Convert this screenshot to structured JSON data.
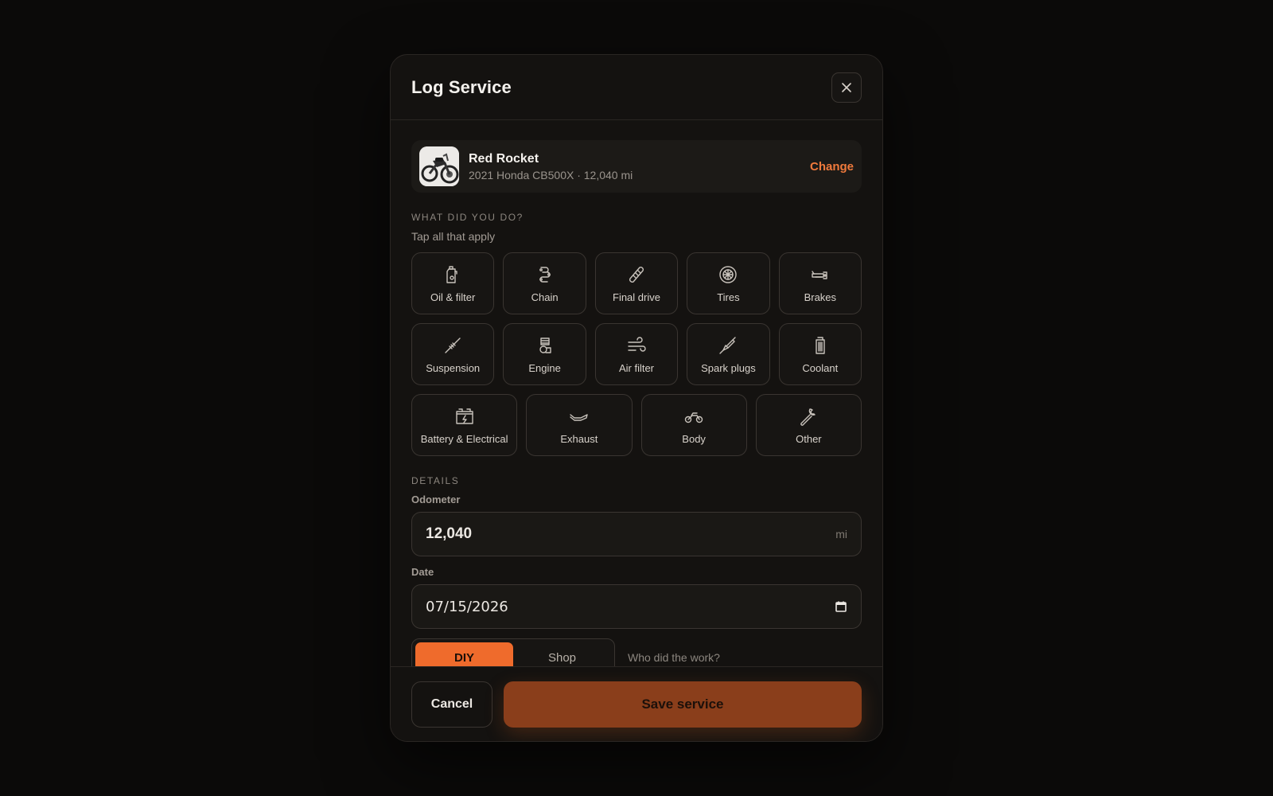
{
  "modal": {
    "title": "Log Service"
  },
  "bike": {
    "name": "Red Rocket",
    "meta": "2021 Honda CB500X · 12,040 mi",
    "change_label": "Change"
  },
  "what_section": {
    "label": "WHAT DID YOU DO?",
    "hint": "Tap all that apply",
    "row1": [
      {
        "label": "Oil & filter",
        "icon": "oil-can-icon"
      },
      {
        "label": "Chain",
        "icon": "chain-icon"
      },
      {
        "label": "Final drive",
        "icon": "belt-icon"
      },
      {
        "label": "Tires",
        "icon": "tire-icon"
      },
      {
        "label": "Brakes",
        "icon": "brake-lever-icon"
      }
    ],
    "row2": [
      {
        "label": "Suspension",
        "icon": "shock-absorber-icon"
      },
      {
        "label": "Engine",
        "icon": "engine-icon"
      },
      {
        "label": "Air filter",
        "icon": "wind-icon"
      },
      {
        "label": "Spark plugs",
        "icon": "spark-plug-icon"
      },
      {
        "label": "Coolant",
        "icon": "radiator-icon"
      }
    ],
    "row3": [
      {
        "label": "Battery & Electrical",
        "icon": "battery-icon"
      },
      {
        "label": "Exhaust",
        "icon": "exhaust-icon"
      },
      {
        "label": "Body",
        "icon": "motorcycle-icon"
      },
      {
        "label": "Other",
        "icon": "wrench-icon"
      }
    ]
  },
  "details": {
    "label": "DETAILS",
    "odometer_label": "Odometer",
    "odometer_value": "12,040",
    "odometer_unit": "mi",
    "date_label": "Date",
    "date_value": "07/15/2026",
    "who": {
      "options": [
        "DIY",
        "Shop"
      ],
      "selected": "DIY",
      "label": "Who did the work?"
    }
  },
  "footer": {
    "cancel_label": "Cancel",
    "save_label": "Save service"
  },
  "colors": {
    "accent": "#ef6b2c",
    "save_button": "#8a3e1b",
    "background": "#0b0a09",
    "modal": "#141210"
  }
}
